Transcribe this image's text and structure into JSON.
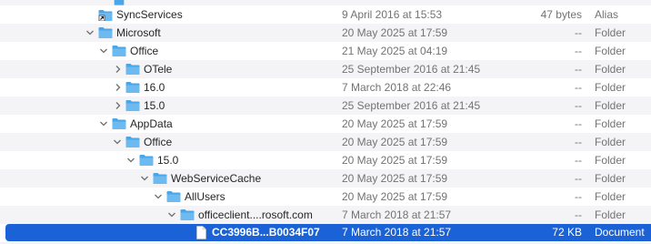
{
  "colors": {
    "selection": "#1b62d6",
    "folder": "#4aa6e8",
    "folder_tab": "#6cbaf0",
    "zebra": "#f4f4f6"
  },
  "rows": [
    {
      "name": "SyncServices",
      "date": "9 April 2016 at 15:53",
      "size": "47 bytes",
      "kind": "Alias",
      "icon": "alias-icon",
      "disclosure": "none"
    },
    {
      "name": "Microsoft",
      "date": "20 May 2025 at 17:59",
      "size": "--",
      "kind": "Folder",
      "icon": "folder-icon",
      "disclosure": "expanded"
    },
    {
      "name": "Office",
      "date": "21 May 2025 at 04:19",
      "size": "--",
      "kind": "Folder",
      "icon": "folder-icon",
      "disclosure": "expanded"
    },
    {
      "name": "OTele",
      "date": "25 September 2016 at 21:45",
      "size": "--",
      "kind": "Folder",
      "icon": "folder-icon",
      "disclosure": "collapsed"
    },
    {
      "name": "16.0",
      "date": "7 March 2018 at 22:46",
      "size": "--",
      "kind": "Folder",
      "icon": "folder-icon",
      "disclosure": "collapsed"
    },
    {
      "name": "15.0",
      "date": "25 September 2016 at 21:45",
      "size": "--",
      "kind": "Folder",
      "icon": "folder-icon",
      "disclosure": "collapsed"
    },
    {
      "name": "AppData",
      "date": "20 May 2025 at 17:59",
      "size": "--",
      "kind": "Folder",
      "icon": "folder-icon",
      "disclosure": "expanded"
    },
    {
      "name": "Office",
      "date": "20 May 2025 at 17:59",
      "size": "--",
      "kind": "Folder",
      "icon": "folder-icon",
      "disclosure": "expanded"
    },
    {
      "name": "15.0",
      "date": "20 May 2025 at 17:59",
      "size": "--",
      "kind": "Folder",
      "icon": "folder-icon",
      "disclosure": "expanded"
    },
    {
      "name": "WebServiceCache",
      "date": "20 May 2025 at 17:59",
      "size": "--",
      "kind": "Folder",
      "icon": "folder-icon",
      "disclosure": "expanded"
    },
    {
      "name": "AllUsers",
      "date": "20 May 2025 at 17:59",
      "size": "--",
      "kind": "Folder",
      "icon": "folder-icon",
      "disclosure": "expanded"
    },
    {
      "name": "officeclient....rosoft.com",
      "date": "7 March 2018 at 21:57",
      "size": "--",
      "kind": "Folder",
      "icon": "folder-icon",
      "disclosure": "expanded"
    },
    {
      "name": "CC3996B...B0034F07",
      "date": "7 March 2018 at 21:57",
      "size": "72 KB",
      "kind": "Document",
      "icon": "document-icon",
      "disclosure": "none",
      "selected": true
    }
  ]
}
